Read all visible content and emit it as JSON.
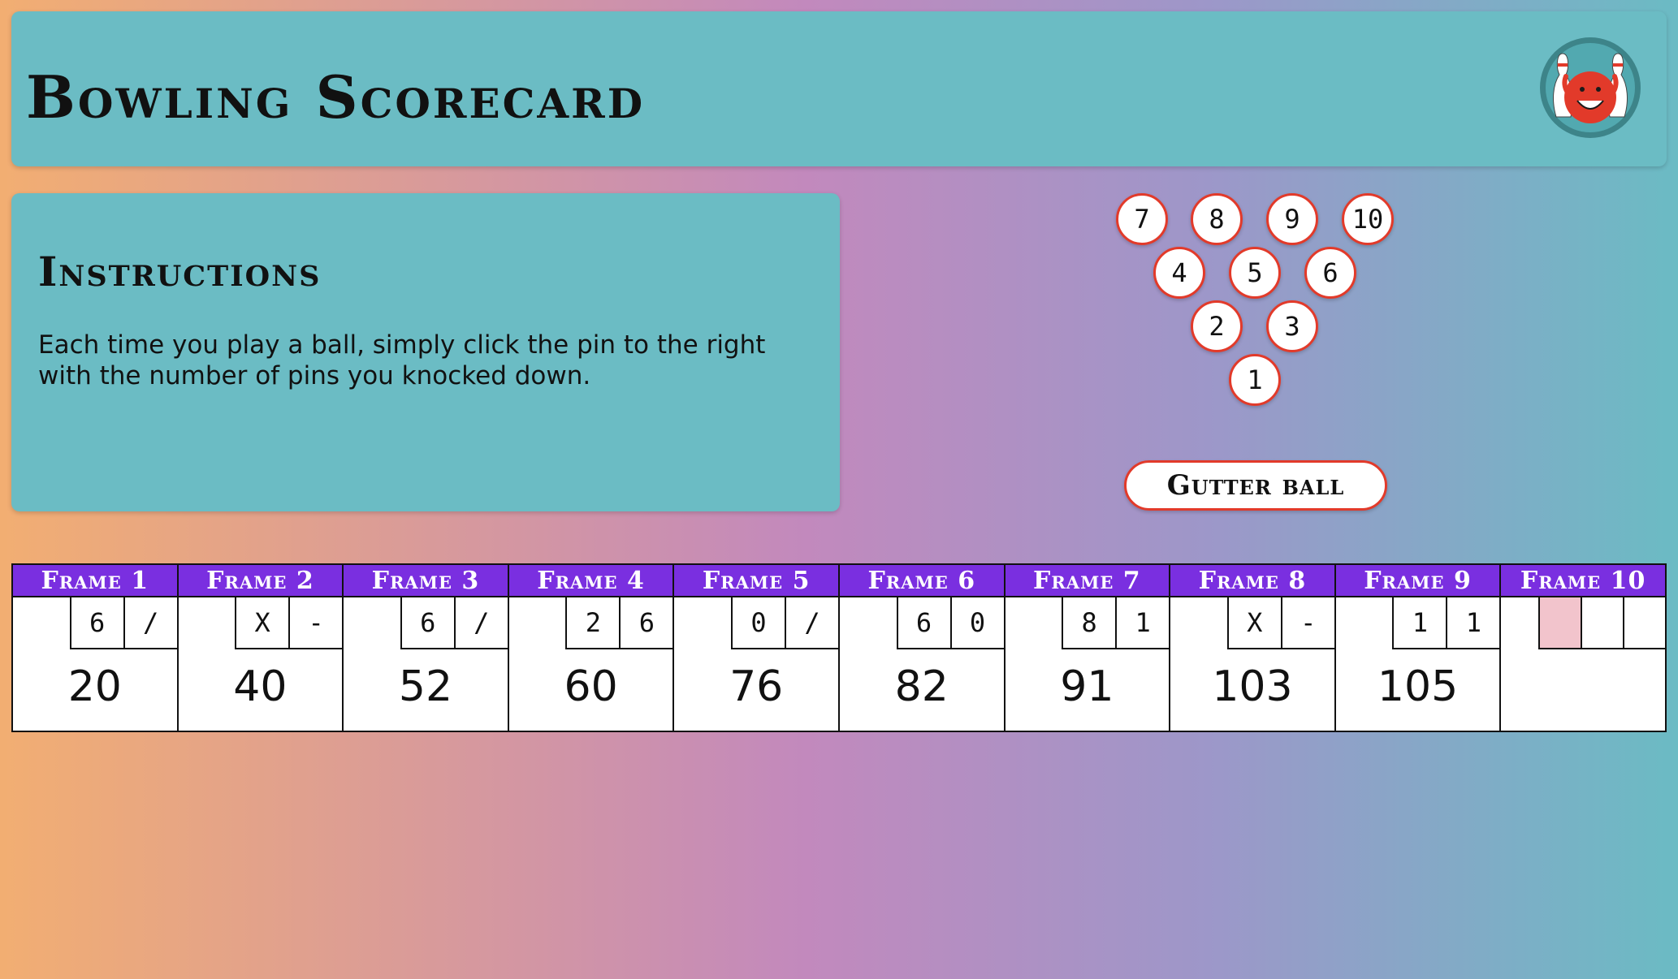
{
  "app": {
    "title": "Bowling Scorecard"
  },
  "instructions": {
    "title": "Instructions",
    "text": "Each time you play a ball, simply click the pin to the right with the number of pins you knocked down."
  },
  "pins": [
    "1",
    "2",
    "3",
    "4",
    "5",
    "6",
    "7",
    "8",
    "9",
    "10"
  ],
  "gutter_label": "Gutter ball",
  "frames": [
    {
      "label": "Frame 1",
      "roll1": "6",
      "roll2": "/",
      "total": "20"
    },
    {
      "label": "Frame 2",
      "roll1": "X",
      "roll2": "-",
      "total": "40"
    },
    {
      "label": "Frame 3",
      "roll1": "6",
      "roll2": "/",
      "total": "52"
    },
    {
      "label": "Frame 4",
      "roll1": "2",
      "roll2": "6",
      "total": "60"
    },
    {
      "label": "Frame 5",
      "roll1": "0",
      "roll2": "/",
      "total": "76"
    },
    {
      "label": "Frame 6",
      "roll1": "6",
      "roll2": "0",
      "total": "82"
    },
    {
      "label": "Frame 7",
      "roll1": "8",
      "roll2": "1",
      "total": "91"
    },
    {
      "label": "Frame 8",
      "roll1": "X",
      "roll2": "-",
      "total": "103"
    },
    {
      "label": "Frame 9",
      "roll1": "1",
      "roll2": "1",
      "total": "105"
    },
    {
      "label": "Frame 10",
      "roll1": "",
      "roll2": "",
      "roll3": "",
      "total": ""
    }
  ],
  "colors": {
    "panel": "#6bbcc4",
    "frame_header": "#7a2fe0",
    "pin_border": "#e23a2a",
    "active_roll": "#f2c4cc"
  },
  "icons": {
    "logo": "bowling-ball-with-pins-logo"
  }
}
